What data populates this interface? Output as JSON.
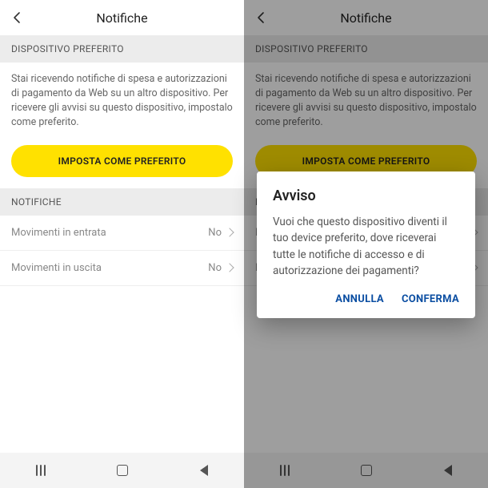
{
  "header": {
    "title": "Notifiche"
  },
  "preferred": {
    "section_label": "DISPOSITIVO PREFERITO",
    "body": "Stai ricevendo notifiche di spesa e autorizzazioni di pagamento da Web su un altro dispositivo. Per ricevere gli avvisi su questo dispositivo, impostalo come preferito.",
    "button_label": "IMPOSTA COME PREFERITO"
  },
  "notifications": {
    "section_label": "NOTIFICHE",
    "rows": [
      {
        "label": "Movimenti in entrata",
        "value": "No"
      },
      {
        "label": "Movimenti in uscita",
        "value": "No"
      }
    ]
  },
  "dialog": {
    "title": "Avviso",
    "body": "Vuoi che questo dispositivo diventi il tuo device preferito, dove riceverai tutte le notifiche di accesso e di autorizzazione dei pagamenti?",
    "cancel": "ANNULLA",
    "confirm": "CONFERMA"
  }
}
